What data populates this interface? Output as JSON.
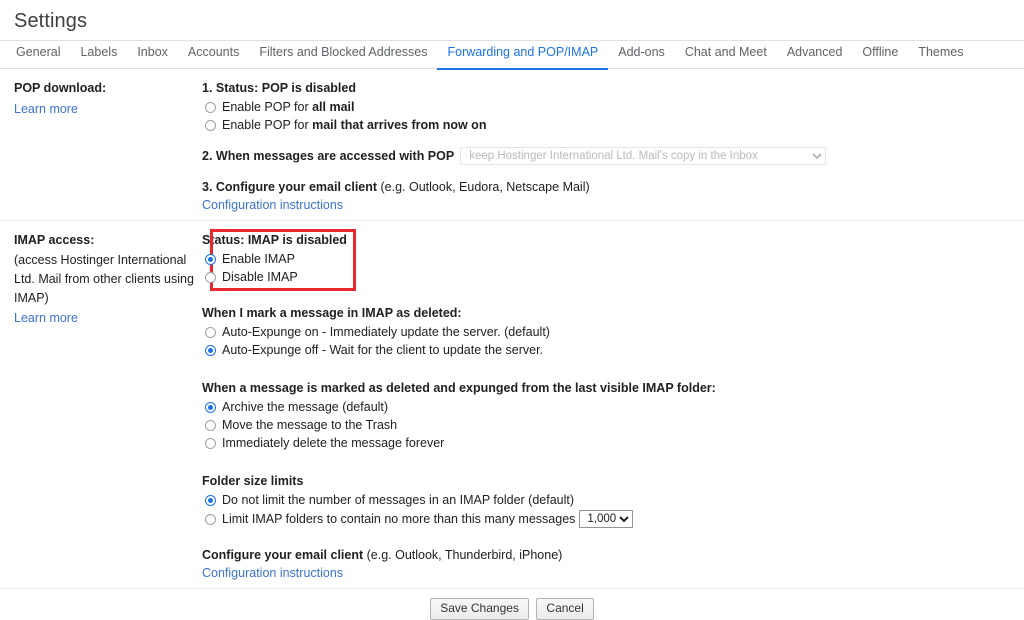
{
  "header": {
    "title": "Settings"
  },
  "tabs": [
    {
      "label": "General",
      "active": false
    },
    {
      "label": "Labels",
      "active": false
    },
    {
      "label": "Inbox",
      "active": false
    },
    {
      "label": "Accounts",
      "active": false
    },
    {
      "label": "Filters and Blocked Addresses",
      "active": false
    },
    {
      "label": "Forwarding and POP/IMAP",
      "active": true
    },
    {
      "label": "Add-ons",
      "active": false
    },
    {
      "label": "Chat and Meet",
      "active": false
    },
    {
      "label": "Advanced",
      "active": false
    },
    {
      "label": "Offline",
      "active": false
    },
    {
      "label": "Themes",
      "active": false
    }
  ],
  "pop": {
    "label_title": "POP download:",
    "learn_more": "Learn more",
    "step1_heading": "1. Status: POP is disabled",
    "options": [
      {
        "prefix": "Enable POP for ",
        "strong": "all mail",
        "checked": false
      },
      {
        "prefix": "Enable POP for ",
        "strong": "mail that arrives from now on",
        "checked": false
      }
    ],
    "step2_label": "2. When messages are accessed with POP",
    "step2_select_value": "keep Hostinger International Ltd. Mail's copy in the Inbox",
    "step3_bold": "3. Configure your email client",
    "step3_normal": " (e.g. Outlook, Eudora, Netscape Mail)",
    "step3_link": "Configuration instructions"
  },
  "imap": {
    "label_title": "IMAP access:",
    "label_desc": "(access Hostinger International Ltd. Mail from other clients using IMAP)",
    "learn_more": "Learn more",
    "status_heading": "Status: IMAP is disabled",
    "status_options": [
      {
        "label": "Enable IMAP",
        "checked": true
      },
      {
        "label": "Disable IMAP",
        "checked": false
      }
    ],
    "expunge_heading": "When I mark a message in IMAP as deleted:",
    "expunge_options": [
      {
        "label": "Auto-Expunge on - Immediately update the server. (default)",
        "checked": false
      },
      {
        "label": "Auto-Expunge off - Wait for the client to update the server.",
        "checked": true
      }
    ],
    "deleted_heading": "When a message is marked as deleted and expunged from the last visible IMAP folder:",
    "deleted_options": [
      {
        "label": "Archive the message (default)",
        "checked": true
      },
      {
        "label": "Move the message to the Trash",
        "checked": false
      },
      {
        "label": "Immediately delete the message forever",
        "checked": false
      }
    ],
    "folder_heading": "Folder size limits",
    "folder_options": [
      {
        "label": "Do not limit the number of messages in an IMAP folder (default)",
        "checked": true
      },
      {
        "label": "Limit IMAP folders to contain no more than this many messages",
        "checked": false
      }
    ],
    "folder_limit_value": "1,000",
    "configure_bold": "Configure your email client",
    "configure_normal": " (e.g. Outlook, Thunderbird, iPhone)",
    "configure_link": "Configuration instructions"
  },
  "footer": {
    "save_label": "Save Changes",
    "cancel_label": "Cancel"
  },
  "colors": {
    "accent": "#1a73e8",
    "link": "#3b73d1",
    "highlight": "#e8282c"
  }
}
